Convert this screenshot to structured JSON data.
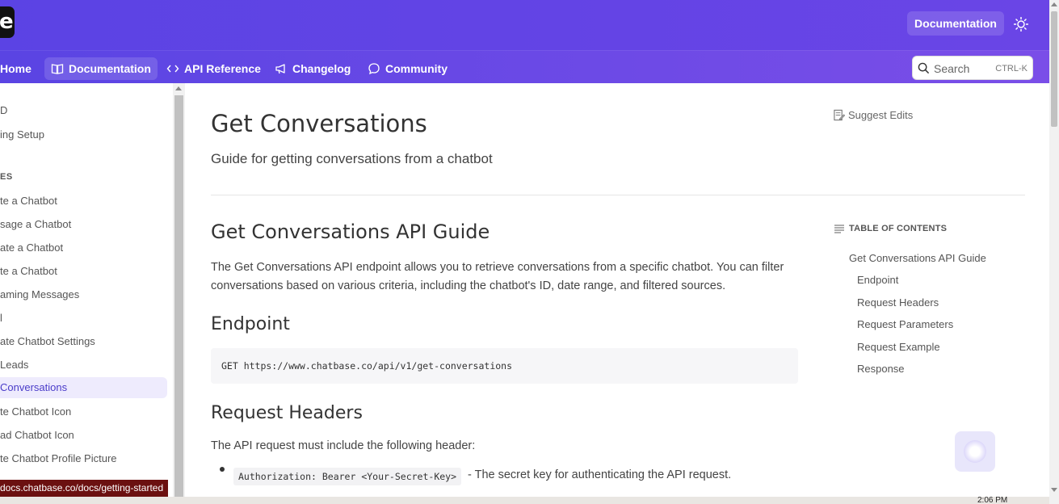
{
  "header": {
    "logo_letter": "e",
    "doc_button": "Documentation"
  },
  "nav": {
    "items": [
      {
        "label": "Home",
        "icon": "home-icon"
      },
      {
        "label": "Documentation",
        "icon": "book-icon"
      },
      {
        "label": "API Reference",
        "icon": "code-icon"
      },
      {
        "label": "Changelog",
        "icon": "megaphone-icon"
      },
      {
        "label": "Community",
        "icon": "chat-bubble-icon"
      }
    ],
    "search_placeholder": "Search",
    "search_shortcut": "CTRL-K"
  },
  "sidebar": {
    "items": [
      {
        "label": "D"
      },
      {
        "label": "ing Setup"
      },
      {
        "label": "ES"
      },
      {
        "label": "te a Chatbot"
      },
      {
        "label": "sage a Chatbot"
      },
      {
        "label": "ate a Chatbot"
      },
      {
        "label": "te a Chatbot"
      },
      {
        "label": "aming Messages"
      },
      {
        "label": "l"
      },
      {
        "label": "ate Chatbot Settings"
      },
      {
        "label": "Leads"
      },
      {
        "label": "Conversations"
      },
      {
        "label": "te Chatbot Icon"
      },
      {
        "label": "ad Chatbot Icon"
      },
      {
        "label": "te Chatbot Profile Picture"
      }
    ]
  },
  "main": {
    "title": "Get Conversations",
    "subtitle": "Guide for getting conversations from a chatbot",
    "suggest_edits": "Suggest Edits",
    "section_title": "Get Conversations API Guide",
    "section_para": "The Get Conversations API endpoint allows you to retrieve conversations from a specific chatbot. You can filter conversations based on various criteria, including the chatbot's ID, date range, and filtered sources.",
    "endpoint_title": "Endpoint",
    "endpoint_code": "GET https://www.chatbase.co/api/v1/get-conversations",
    "headers_title": "Request Headers",
    "headers_para": "The API request must include the following header:",
    "header_code": "Authorization: Bearer <Your-Secret-Key>",
    "header_desc": "- The secret key for authenticating the API request."
  },
  "toc": {
    "heading": "TABLE OF CONTENTS",
    "items": [
      "Get Conversations API Guide",
      "Endpoint",
      "Request Headers",
      "Request Parameters",
      "Request Example",
      "Response"
    ]
  },
  "status_url": "docs.chatbase.co/docs/getting-started",
  "taskbar_time": "2:06 PM",
  "colors": {
    "header": "#5b43e4",
    "active_sidebar": "#eeebfd",
    "status_bg": "#6b1010"
  }
}
